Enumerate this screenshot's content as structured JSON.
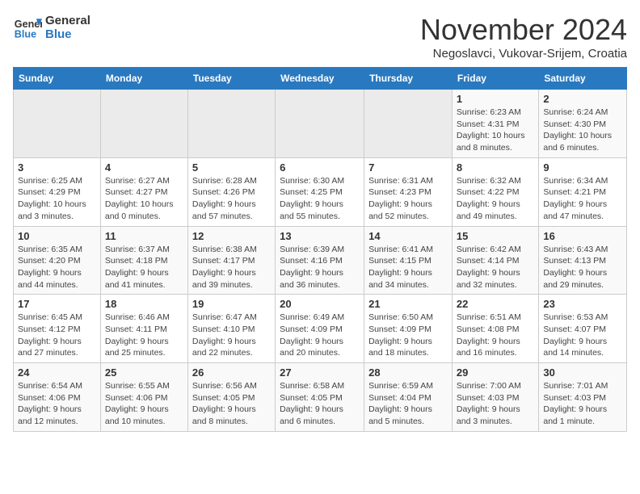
{
  "logo": {
    "line1": "General",
    "line2": "Blue"
  },
  "title": "November 2024",
  "subtitle": "Negoslavci, Vukovar-Srijem, Croatia",
  "days_of_week": [
    "Sunday",
    "Monday",
    "Tuesday",
    "Wednesday",
    "Thursday",
    "Friday",
    "Saturday"
  ],
  "weeks": [
    [
      {
        "day": "",
        "info": ""
      },
      {
        "day": "",
        "info": ""
      },
      {
        "day": "",
        "info": ""
      },
      {
        "day": "",
        "info": ""
      },
      {
        "day": "",
        "info": ""
      },
      {
        "day": "1",
        "info": "Sunrise: 6:23 AM\nSunset: 4:31 PM\nDaylight: 10 hours and 8 minutes."
      },
      {
        "day": "2",
        "info": "Sunrise: 6:24 AM\nSunset: 4:30 PM\nDaylight: 10 hours and 6 minutes."
      }
    ],
    [
      {
        "day": "3",
        "info": "Sunrise: 6:25 AM\nSunset: 4:29 PM\nDaylight: 10 hours and 3 minutes."
      },
      {
        "day": "4",
        "info": "Sunrise: 6:27 AM\nSunset: 4:27 PM\nDaylight: 10 hours and 0 minutes."
      },
      {
        "day": "5",
        "info": "Sunrise: 6:28 AM\nSunset: 4:26 PM\nDaylight: 9 hours and 57 minutes."
      },
      {
        "day": "6",
        "info": "Sunrise: 6:30 AM\nSunset: 4:25 PM\nDaylight: 9 hours and 55 minutes."
      },
      {
        "day": "7",
        "info": "Sunrise: 6:31 AM\nSunset: 4:23 PM\nDaylight: 9 hours and 52 minutes."
      },
      {
        "day": "8",
        "info": "Sunrise: 6:32 AM\nSunset: 4:22 PM\nDaylight: 9 hours and 49 minutes."
      },
      {
        "day": "9",
        "info": "Sunrise: 6:34 AM\nSunset: 4:21 PM\nDaylight: 9 hours and 47 minutes."
      }
    ],
    [
      {
        "day": "10",
        "info": "Sunrise: 6:35 AM\nSunset: 4:20 PM\nDaylight: 9 hours and 44 minutes."
      },
      {
        "day": "11",
        "info": "Sunrise: 6:37 AM\nSunset: 4:18 PM\nDaylight: 9 hours and 41 minutes."
      },
      {
        "day": "12",
        "info": "Sunrise: 6:38 AM\nSunset: 4:17 PM\nDaylight: 9 hours and 39 minutes."
      },
      {
        "day": "13",
        "info": "Sunrise: 6:39 AM\nSunset: 4:16 PM\nDaylight: 9 hours and 36 minutes."
      },
      {
        "day": "14",
        "info": "Sunrise: 6:41 AM\nSunset: 4:15 PM\nDaylight: 9 hours and 34 minutes."
      },
      {
        "day": "15",
        "info": "Sunrise: 6:42 AM\nSunset: 4:14 PM\nDaylight: 9 hours and 32 minutes."
      },
      {
        "day": "16",
        "info": "Sunrise: 6:43 AM\nSunset: 4:13 PM\nDaylight: 9 hours and 29 minutes."
      }
    ],
    [
      {
        "day": "17",
        "info": "Sunrise: 6:45 AM\nSunset: 4:12 PM\nDaylight: 9 hours and 27 minutes."
      },
      {
        "day": "18",
        "info": "Sunrise: 6:46 AM\nSunset: 4:11 PM\nDaylight: 9 hours and 25 minutes."
      },
      {
        "day": "19",
        "info": "Sunrise: 6:47 AM\nSunset: 4:10 PM\nDaylight: 9 hours and 22 minutes."
      },
      {
        "day": "20",
        "info": "Sunrise: 6:49 AM\nSunset: 4:09 PM\nDaylight: 9 hours and 20 minutes."
      },
      {
        "day": "21",
        "info": "Sunrise: 6:50 AM\nSunset: 4:09 PM\nDaylight: 9 hours and 18 minutes."
      },
      {
        "day": "22",
        "info": "Sunrise: 6:51 AM\nSunset: 4:08 PM\nDaylight: 9 hours and 16 minutes."
      },
      {
        "day": "23",
        "info": "Sunrise: 6:53 AM\nSunset: 4:07 PM\nDaylight: 9 hours and 14 minutes."
      }
    ],
    [
      {
        "day": "24",
        "info": "Sunrise: 6:54 AM\nSunset: 4:06 PM\nDaylight: 9 hours and 12 minutes."
      },
      {
        "day": "25",
        "info": "Sunrise: 6:55 AM\nSunset: 4:06 PM\nDaylight: 9 hours and 10 minutes."
      },
      {
        "day": "26",
        "info": "Sunrise: 6:56 AM\nSunset: 4:05 PM\nDaylight: 9 hours and 8 minutes."
      },
      {
        "day": "27",
        "info": "Sunrise: 6:58 AM\nSunset: 4:05 PM\nDaylight: 9 hours and 6 minutes."
      },
      {
        "day": "28",
        "info": "Sunrise: 6:59 AM\nSunset: 4:04 PM\nDaylight: 9 hours and 5 minutes."
      },
      {
        "day": "29",
        "info": "Sunrise: 7:00 AM\nSunset: 4:03 PM\nDaylight: 9 hours and 3 minutes."
      },
      {
        "day": "30",
        "info": "Sunrise: 7:01 AM\nSunset: 4:03 PM\nDaylight: 9 hours and 1 minute."
      }
    ]
  ]
}
